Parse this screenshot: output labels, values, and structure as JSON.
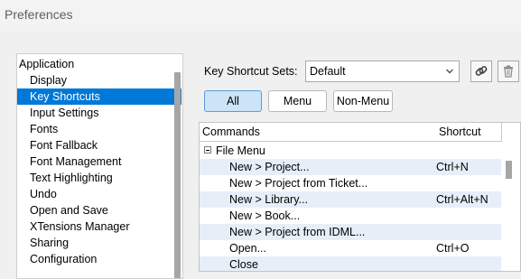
{
  "window": {
    "title": "Preferences"
  },
  "tree": {
    "items": [
      {
        "label": "Application",
        "level": "root",
        "selected": false
      },
      {
        "label": "Display",
        "level": "child",
        "selected": false
      },
      {
        "label": "Key Shortcuts",
        "level": "child",
        "selected": true
      },
      {
        "label": "Input Settings",
        "level": "child",
        "selected": false
      },
      {
        "label": "Fonts",
        "level": "child",
        "selected": false
      },
      {
        "label": "Font Fallback",
        "level": "child",
        "selected": false
      },
      {
        "label": "Font Management",
        "level": "child",
        "selected": false
      },
      {
        "label": "Text Highlighting",
        "level": "child",
        "selected": false
      },
      {
        "label": "Undo",
        "level": "child",
        "selected": false
      },
      {
        "label": "Open and Save",
        "level": "child",
        "selected": false
      },
      {
        "label": "XTensions Manager",
        "level": "child",
        "selected": false
      },
      {
        "label": "Sharing",
        "level": "child",
        "selected": false
      },
      {
        "label": "Configuration",
        "level": "child",
        "selected": false
      }
    ]
  },
  "shortcut_sets": {
    "label": "Key Shortcut Sets:",
    "value": "Default"
  },
  "filters": {
    "all": "All",
    "menu": "Menu",
    "non_menu": "Non-Menu"
  },
  "table": {
    "headers": {
      "commands": "Commands",
      "shortcut": "Shortcut"
    },
    "group": "File Menu",
    "rows": [
      {
        "command": "New > Project...",
        "shortcut": "Ctrl+N"
      },
      {
        "command": "New > Project from Ticket...",
        "shortcut": ""
      },
      {
        "command": "New > Library...",
        "shortcut": "Ctrl+Alt+N"
      },
      {
        "command": "New > Book...",
        "shortcut": ""
      },
      {
        "command": "New > Project from IDML...",
        "shortcut": ""
      },
      {
        "command": "Open...",
        "shortcut": "Ctrl+O"
      },
      {
        "command": "Close",
        "shortcut": ""
      }
    ]
  },
  "icons": {
    "link": "link-icon",
    "delete": "trash-icon",
    "dropdown": "chevron-down-icon",
    "toggle": "collapse-minus-icon"
  },
  "colors": {
    "selection": "#0078d7",
    "row_shade": "#e6eff8",
    "active_button": "#cce4f7"
  }
}
